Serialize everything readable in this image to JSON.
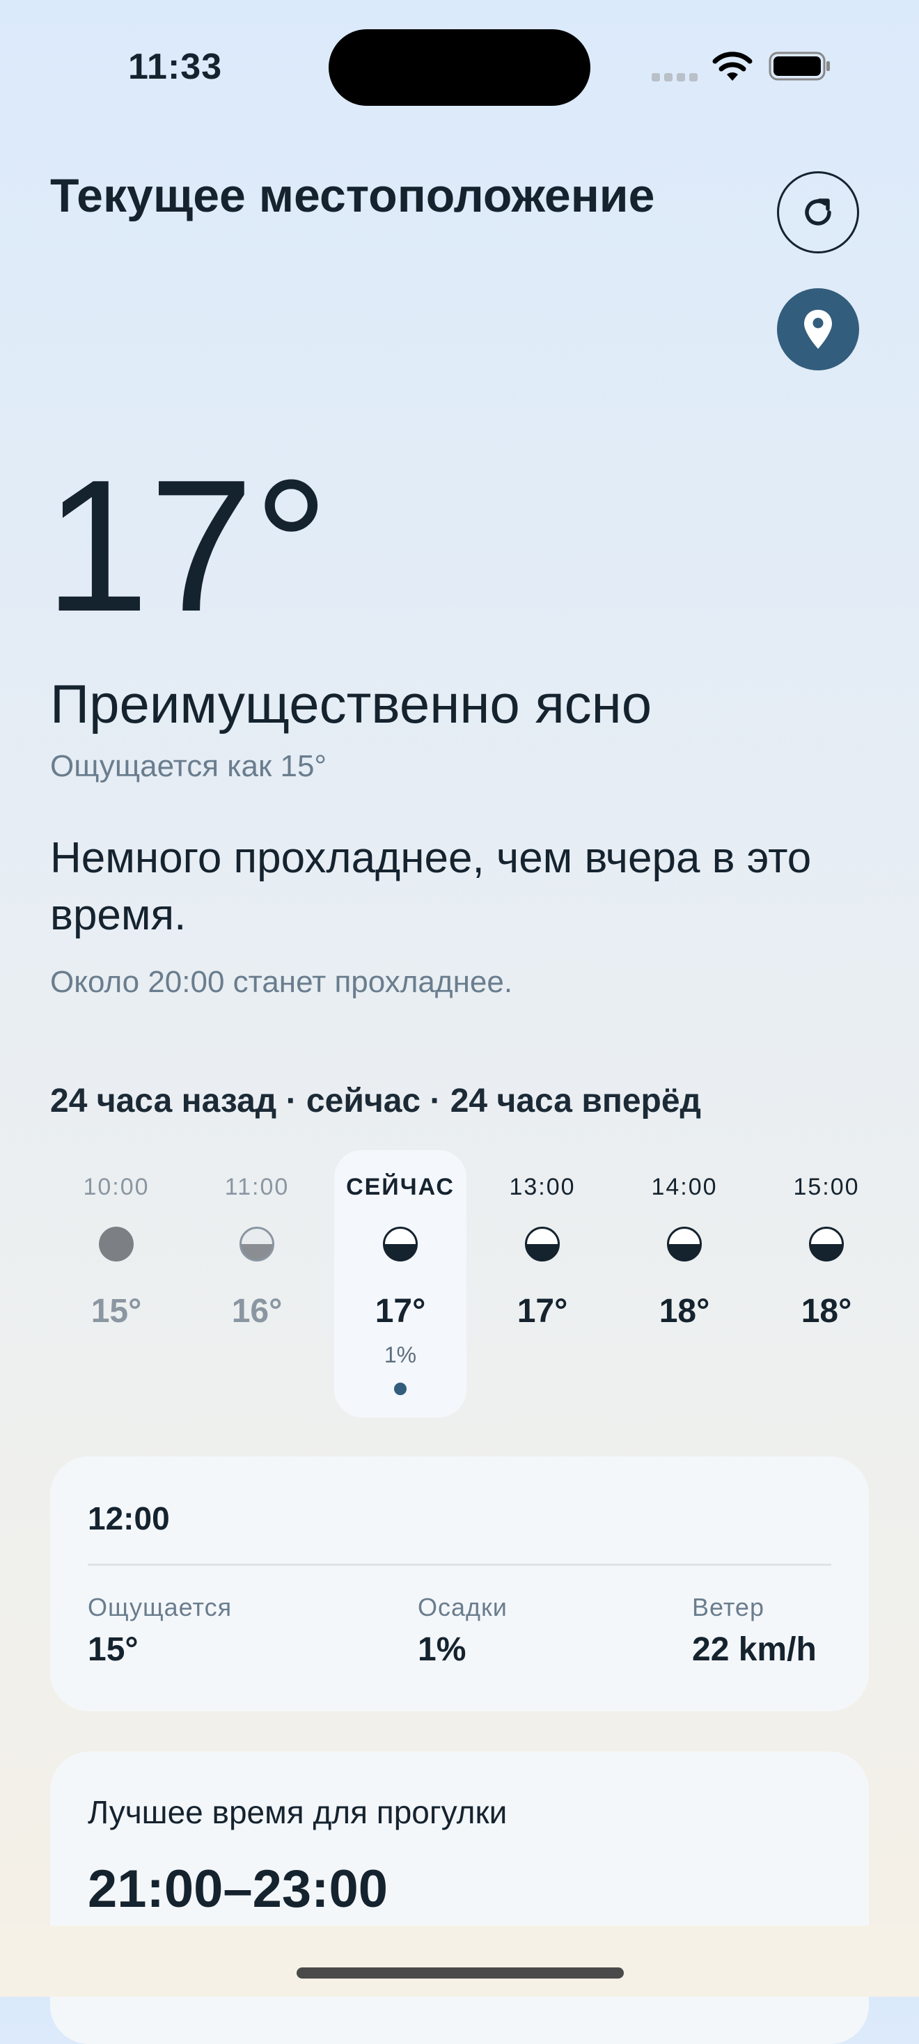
{
  "status_bar": {
    "time": "11:33"
  },
  "header": {
    "title": "Текущее местоположение",
    "refresh_icon": "refresh-icon",
    "location_icon": "location-pin-icon"
  },
  "current": {
    "temperature": "17°",
    "condition": "Преимущественно ясно",
    "feels_like": "Ощущается как 15°",
    "comparison": "Немного прохладнее, чем вчера в это время.",
    "forecast_note": "Около 20:00 станет прохладнее."
  },
  "range_label": "24 часа назад · сейчас · 24 часа вперёд",
  "hourly": [
    {
      "label": "10:00",
      "temp": "15°",
      "icon": "full-moon-icon",
      "state": "past"
    },
    {
      "label": "11:00",
      "temp": "16°",
      "icon": "half-moon-icon",
      "state": "past"
    },
    {
      "label": "СЕЙЧАС",
      "temp": "17°",
      "precip": "1%",
      "icon": "half-moon-icon",
      "state": "now"
    },
    {
      "label": "13:00",
      "temp": "17°",
      "icon": "half-moon-icon",
      "state": "future"
    },
    {
      "label": "14:00",
      "temp": "18°",
      "icon": "half-moon-icon",
      "state": "future"
    },
    {
      "label": "15:00",
      "temp": "18°",
      "icon": "half-moon-icon",
      "state": "future"
    }
  ],
  "detail": {
    "time": "12:00",
    "metrics": [
      {
        "label": "Ощущается",
        "value": "15°"
      },
      {
        "label": "Осадки",
        "value": "1%"
      },
      {
        "label": "Ветер",
        "value": "22 km/h"
      }
    ]
  },
  "walk": {
    "label": "Лучшее время для прогулки",
    "time": "21:00–23:00"
  },
  "colors": {
    "accent": "#335d7c",
    "text": "#15232f",
    "muted": "#6a7d8e"
  }
}
